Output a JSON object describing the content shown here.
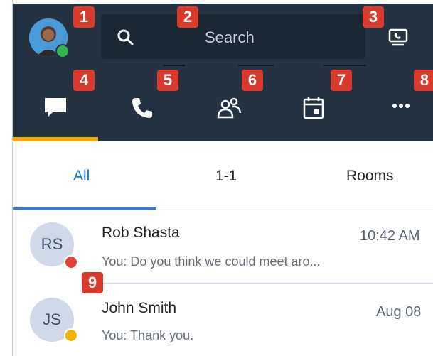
{
  "header": {
    "search_placeholder": "Search",
    "badges": [
      "1",
      "2",
      "3",
      "4",
      "5",
      "6",
      "7",
      "8"
    ]
  },
  "tabs": [
    {
      "label": "All"
    },
    {
      "label": "1-1"
    },
    {
      "label": "Rooms"
    }
  ],
  "conversations": [
    {
      "initials": "RS",
      "name": "Rob Shasta",
      "time": "10:42 AM",
      "preview": "You: Do you think we could meet aro...",
      "status_color": "#e0433a"
    },
    {
      "initials": "JS",
      "name": "John Smith",
      "time": "Aug 08",
      "preview": "You: Thank you.",
      "status_color": "#f2b400"
    }
  ],
  "callout": {
    "badge": "9"
  },
  "colors": {
    "header_bg": "#243242",
    "accent_blue": "#1a73e8",
    "active_yellow": "#f2a900",
    "badge_red": "#d93a2b"
  }
}
